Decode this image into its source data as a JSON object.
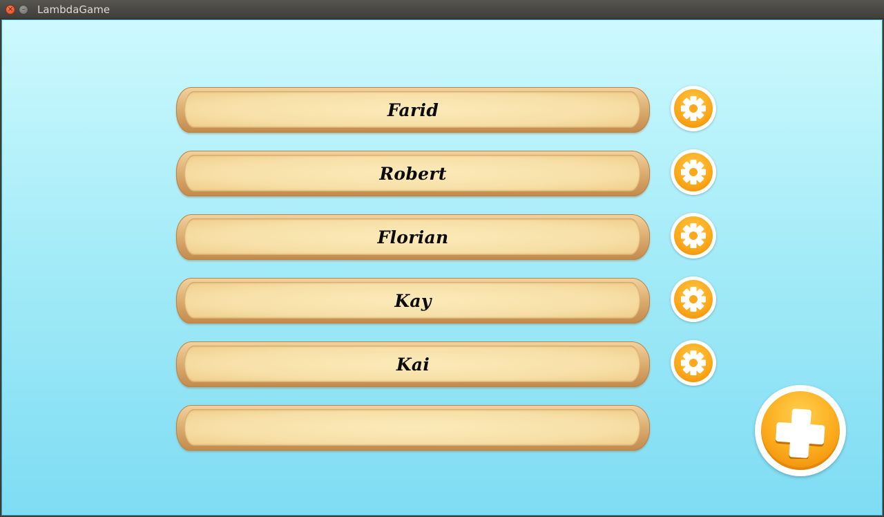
{
  "window": {
    "title": "LambdaGame",
    "close_glyph": "×",
    "minimize_glyph": "–"
  },
  "profiles": [
    {
      "name": "Farid",
      "settings_icon": "gear-icon"
    },
    {
      "name": "Robert",
      "settings_icon": "gear-icon"
    },
    {
      "name": "Florian",
      "settings_icon": "gear-icon"
    },
    {
      "name": "Kay",
      "settings_icon": "gear-icon"
    },
    {
      "name": "Kai",
      "settings_icon": "gear-icon"
    }
  ],
  "empty_slot": {
    "name": ""
  },
  "add_button": {
    "icon": "plus-icon"
  },
  "colors": {
    "sky_top": "#cdf9fe",
    "sky_bottom": "#7edcf3",
    "parchment": "#f7e0a8",
    "button_orange": "#fca719",
    "button_white": "#ffffff"
  }
}
